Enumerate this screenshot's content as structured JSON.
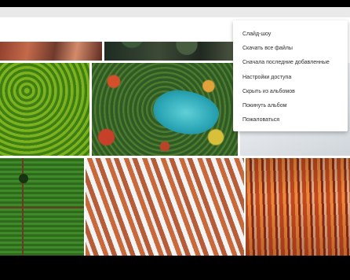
{
  "menu": {
    "items": [
      {
        "label": "Слайд-шоу"
      },
      {
        "label": "Скачать все файлы"
      },
      {
        "label": "Сначала последние добавленные"
      },
      {
        "label": "Настройки доступа"
      },
      {
        "label": "Скрыть из альбомов"
      },
      {
        "label": "Покинуть альбом"
      },
      {
        "label": "Пожаловаться"
      }
    ]
  },
  "photos": [
    {
      "subject": "red canyon aerial"
    },
    {
      "subject": "dark forest aerial"
    },
    {
      "subject": "green forest aerial"
    },
    {
      "subject": "turquoise lake in autumn forest"
    },
    {
      "subject": "snowy landscape"
    },
    {
      "subject": "green field with road"
    },
    {
      "subject": "badlands with snow"
    },
    {
      "subject": "bryce canyon hoodoos"
    }
  ],
  "colors": {
    "background": "#ffffff",
    "menu_text": "#2c2d2e",
    "header": "#e9e9e9"
  }
}
